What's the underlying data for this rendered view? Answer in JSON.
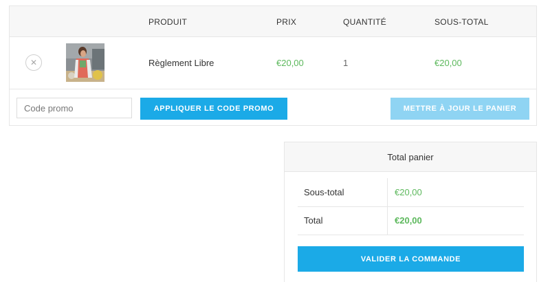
{
  "cart": {
    "headers": {
      "product": "PRODUIT",
      "price": "PRIX",
      "quantity": "QUANTITÉ",
      "subtotal": "SOUS-TOTAL"
    },
    "items": [
      {
        "remove_icon": "close-icon",
        "name": "Règlement Libre",
        "price": "€20,00",
        "quantity": "1",
        "subtotal": "€20,00"
      }
    ],
    "coupon": {
      "placeholder": "Code promo",
      "value": ""
    },
    "apply_coupon_label": "APPLIQUER LE CODE PROMO",
    "update_cart_label": "METTRE À JOUR LE PANIER"
  },
  "totals": {
    "title": "Total panier",
    "subtotal_label": "Sous-total",
    "subtotal_value": "€20,00",
    "total_label": "Total",
    "total_value": "€20,00",
    "checkout_label": "VALIDER LA COMMANDE"
  },
  "colors": {
    "accent": "#1baae7",
    "accent_light": "#8fd4f3",
    "price_green": "#5cb85c"
  }
}
